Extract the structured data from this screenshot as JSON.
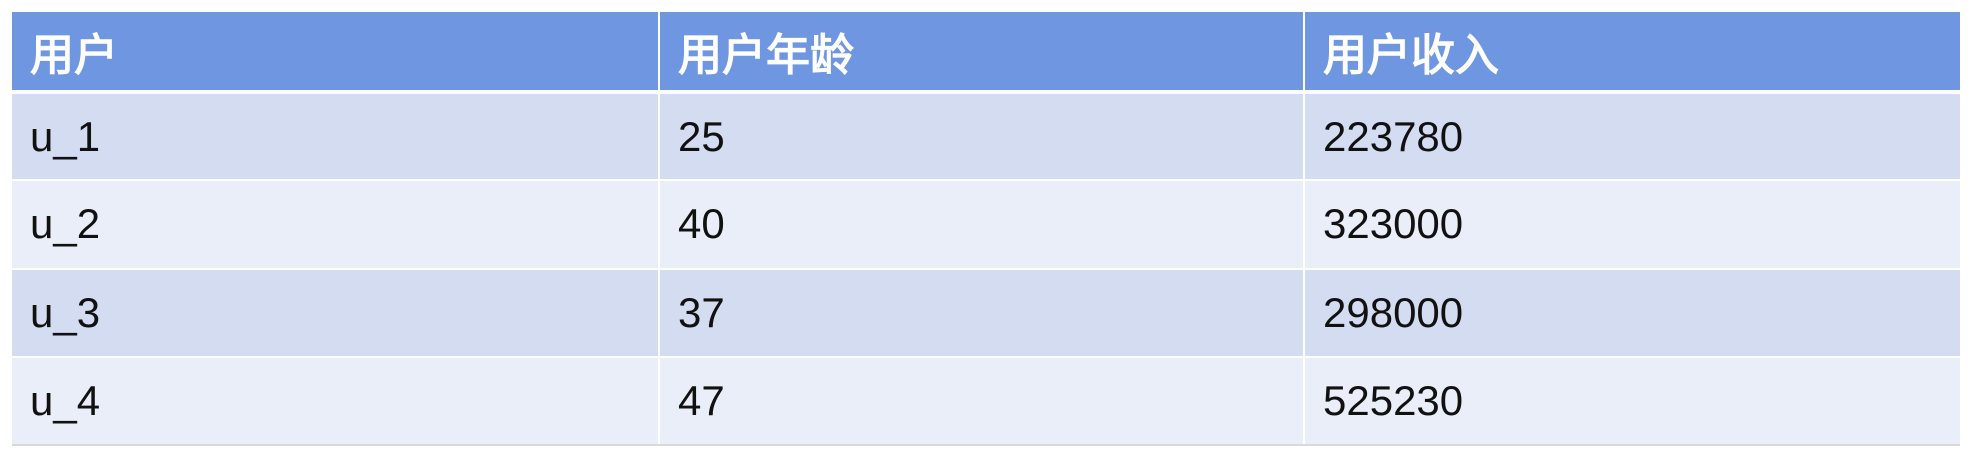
{
  "table": {
    "headers": [
      "用户",
      "用户年龄",
      "用户收入"
    ],
    "rows": [
      [
        "u_1",
        "25",
        "223780"
      ],
      [
        "u_2",
        "40",
        "323000"
      ],
      [
        "u_3",
        "37",
        "298000"
      ],
      [
        "u_4",
        "47",
        "525230"
      ]
    ]
  },
  "colors": {
    "header_bg": "#6f96e0",
    "row_odd_bg": "#d3dcf1",
    "row_even_bg": "#eaeef8",
    "header_text": "#ffffff",
    "body_text": "#111111"
  }
}
